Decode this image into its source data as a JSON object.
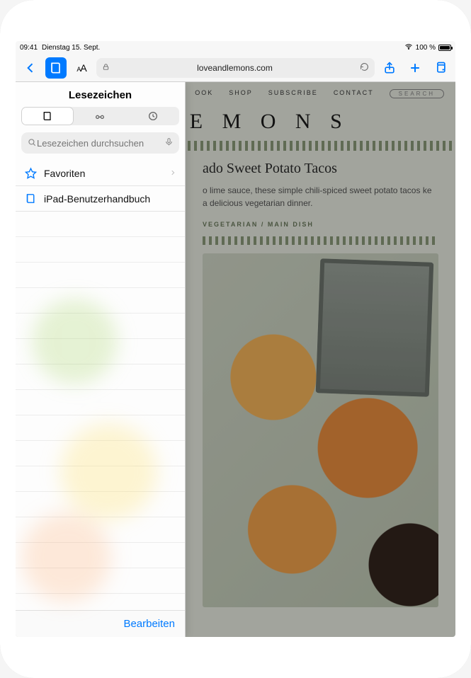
{
  "statusbar": {
    "time": "09:41",
    "date": "Dienstag 15. Sept.",
    "battery_pct": "100 %"
  },
  "toolbar": {
    "url": "loveandlemons.com",
    "aa_label": "AA"
  },
  "sidebar": {
    "title": "Lesezeichen",
    "search_placeholder": "Lesezeichen durchsuchen",
    "items": [
      {
        "icon": "star-outline",
        "label": "Favoriten",
        "disclosure": true
      },
      {
        "icon": "book",
        "label": "iPad-Benutzerhandbuch",
        "disclosure": false
      }
    ],
    "footer_edit": "Bearbeiten"
  },
  "page": {
    "nav": [
      "OOK",
      "SHOP",
      "SUBSCRIBE",
      "CONTACT"
    ],
    "search_label": "SEARCH",
    "brand_fragment": "& L E M O N S",
    "recipe_title_fragment": "ado Sweet Potato Tacos",
    "recipe_desc_fragment": "o lime sauce, these simple chili-spiced sweet potato tacos ke a delicious vegetarian dinner.",
    "tags": "VEGETARIAN / MAIN DISH"
  }
}
